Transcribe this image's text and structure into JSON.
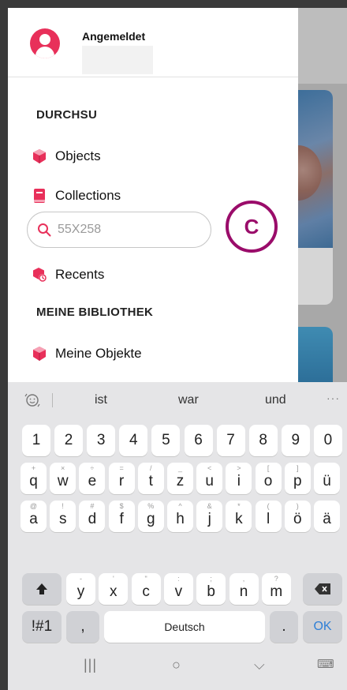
{
  "drawer": {
    "header": {
      "user_label": "Angemeldet"
    },
    "browse_section_title": "DURCHSU",
    "items": [
      {
        "label": "Objects",
        "icon": "cube-icon"
      },
      {
        "label": "Collections",
        "icon": "book-icon"
      },
      {
        "label": "Recents",
        "icon": "recents-icon"
      }
    ],
    "search": {
      "value": "55X258"
    },
    "library_section_title": "MEINE BIBLIOTHEK",
    "library_items": [
      {
        "label": "Meine Objekte",
        "icon": "cube-icon"
      }
    ],
    "callout_label": "C",
    "colors": {
      "accent": "#e8305a",
      "callout": "#9a0c6a"
    }
  },
  "keyboard": {
    "suggestions": [
      "ist",
      "war",
      "und"
    ],
    "more": "···",
    "row_numbers": [
      "1",
      "2",
      "3",
      "4",
      "5",
      "6",
      "7",
      "8",
      "9",
      "0"
    ],
    "row_q": [
      {
        "k": "q",
        "h": "+"
      },
      {
        "k": "w",
        "h": "×"
      },
      {
        "k": "e",
        "h": "÷"
      },
      {
        "k": "r",
        "h": "="
      },
      {
        "k": "t",
        "h": "/"
      },
      {
        "k": "z",
        "h": "_"
      },
      {
        "k": "u",
        "h": "<"
      },
      {
        "k": "i",
        "h": ">"
      },
      {
        "k": "o",
        "h": "["
      },
      {
        "k": "p",
        "h": "]"
      },
      {
        "k": "ü",
        "h": ""
      }
    ],
    "row_a": [
      {
        "k": "a",
        "h": "@"
      },
      {
        "k": "s",
        "h": "!"
      },
      {
        "k": "d",
        "h": "#"
      },
      {
        "k": "f",
        "h": "$"
      },
      {
        "k": "g",
        "h": "%"
      },
      {
        "k": "h",
        "h": "^"
      },
      {
        "k": "j",
        "h": "&"
      },
      {
        "k": "k",
        "h": "*"
      },
      {
        "k": "l",
        "h": "("
      },
      {
        "k": "ö",
        "h": ")"
      },
      {
        "k": "ä",
        "h": ""
      }
    ],
    "row_y": [
      {
        "k": "y",
        "h": "-"
      },
      {
        "k": "x",
        "h": "'"
      },
      {
        "k": "c",
        "h": "\""
      },
      {
        "k": "v",
        "h": ":"
      },
      {
        "k": "b",
        "h": ";"
      },
      {
        "k": "n",
        "h": ","
      },
      {
        "k": "m",
        "h": "?"
      }
    ],
    "symbols_key": "!#1",
    "comma_key": ",",
    "space_label": "Deutsch",
    "period_key": ".",
    "ok_key": "OK"
  },
  "system_nav": {
    "recents": "|||",
    "home": "○",
    "back": "⌵",
    "keyboard": "⌨"
  }
}
